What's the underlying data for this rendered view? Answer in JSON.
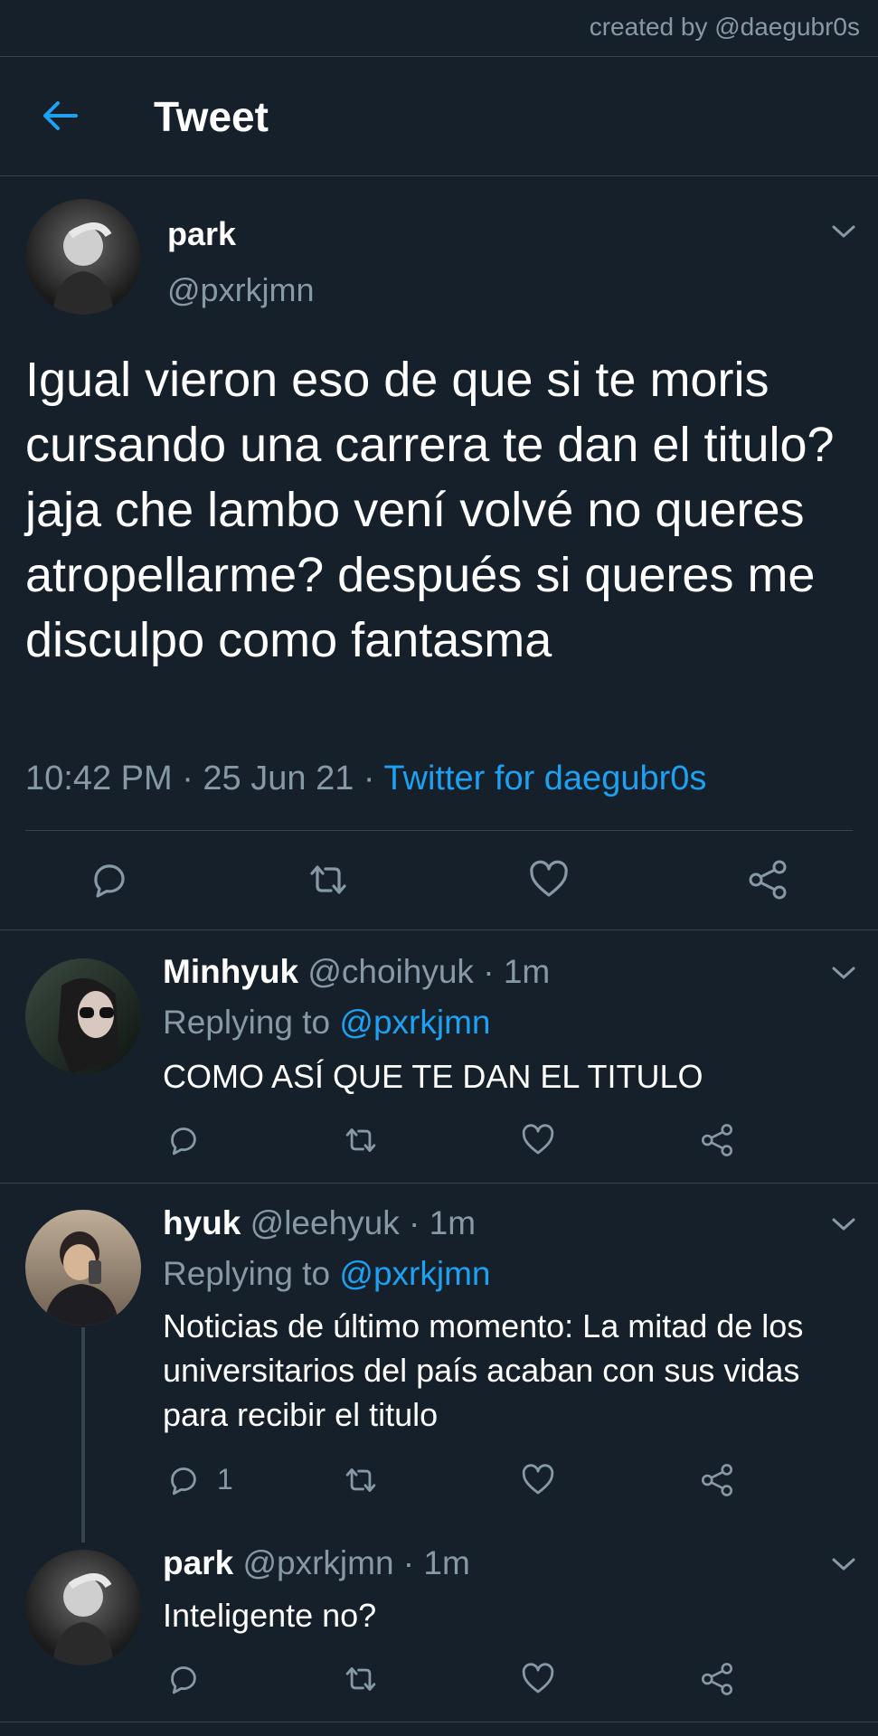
{
  "credit": "created by @daegubr0s",
  "header": {
    "title": "Tweet"
  },
  "main_tweet": {
    "name": "park",
    "handle": "@pxrkjmn",
    "text": "Igual vieron eso de que si te moris cursando una carrera te dan el titulo? jaja che lambo vení volvé no queres atropellarme? después si queres me disculpo como fantasma",
    "time": "10:42 PM · 25 Jun 21 · ",
    "source": "Twitter for daegubr0s"
  },
  "replies": [
    {
      "name": "Minhyuk",
      "handle_time": "@choihyuk · 1m",
      "replying_label": "Replying to ",
      "replying_handle": "@pxrkjmn",
      "text": "COMO ASÍ QUE TE DAN EL TITULO"
    },
    {
      "name": "hyuk",
      "handle_time": "@leehyuk · 1m",
      "replying_label": "Replying to ",
      "replying_handle": "@pxrkjmn",
      "text": "Noticias de último momento: La mitad de los universitarios del país acaban con sus vidas para recibir el titulo",
      "reply_count": "1"
    },
    {
      "name": "park",
      "handle_time": "@pxrkjmn · 1m",
      "text": "Inteligente no?"
    }
  ],
  "icons": {
    "back": "arrow-left-icon",
    "chevron": "chevron-down-icon",
    "reply": "reply-icon",
    "retweet": "retweet-icon",
    "like": "heart-icon",
    "share": "share-icon"
  },
  "colors": {
    "background": "#15202b",
    "accent": "#1da1f2",
    "muted": "#8899a6",
    "divider": "#38444d"
  }
}
